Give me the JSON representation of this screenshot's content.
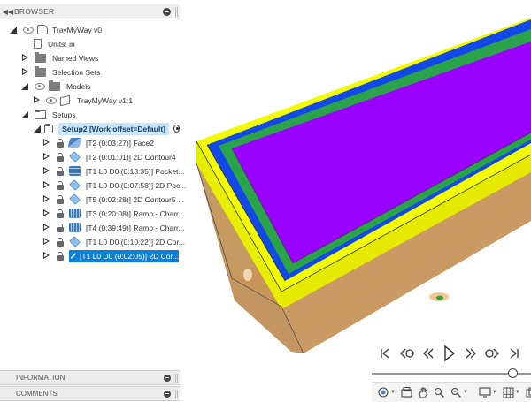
{
  "colors": {
    "selection": "#0b82d9",
    "setup_highlight": "#c6e4fb",
    "stock_top": "#9900ff",
    "contour_blue": "#1248e8",
    "contour_green": "#2aa34a",
    "stock_yellow": "#f2fb00",
    "wood_side": "#c69a63"
  },
  "browser": {
    "header": "BROWSER",
    "tree": [
      {
        "label": "TrayMyWay v0",
        "icon": "component-icon"
      },
      {
        "label": "Units: in",
        "icon": "document-icon"
      },
      {
        "label": "Named Views",
        "icon": "folder-icon"
      },
      {
        "label": "Selection Sets",
        "icon": "folder-icon"
      },
      {
        "label": "Models",
        "icon": "folder-icon"
      },
      {
        "label": "TrayMyWay v1:1",
        "icon": "body-icon"
      },
      {
        "label": "Setups",
        "icon": "folder-open-icon"
      },
      {
        "label": "Setup2 [Work offset=Default]",
        "icon": "folder-open-icon"
      }
    ],
    "operations": [
      {
        "label": "[T2 (0:03:27)] Face2",
        "icon": "face-op-icon"
      },
      {
        "label": "[T2 (0:01:01)] 2D Contour4",
        "icon": "contour-op-icon"
      },
      {
        "label": "[T1 L0 D0 (0:13:35)] Pocket...",
        "icon": "pocket-op-icon"
      },
      {
        "label": "[T1 L0 D0 (0:07:58)] 2D Poc...",
        "icon": "contour-op-icon"
      },
      {
        "label": "[T5 (0:02:28)] 2D Contour5 ...",
        "icon": "contour-op-icon"
      },
      {
        "label": "[T3 (0:20:08)] Ramp - Charr...",
        "icon": "ramp-op-icon"
      },
      {
        "label": "[T4 (0:39:49)] Ramp - Charr...",
        "icon": "ramp-op-icon"
      },
      {
        "label": "[T1 L0 D0 (0:10:22)] 2D Cor...",
        "icon": "contour-op-icon"
      },
      {
        "label": "[T1 L0 D0 (0:02:05)] 2D Cor...",
        "icon": "contour-op-icon",
        "selected": true
      }
    ]
  },
  "information": {
    "header": "INFORMATION"
  },
  "comments": {
    "header": "COMMENTS"
  },
  "playback": {
    "buttons": [
      "go-to-start-icon",
      "previous-icon",
      "rewind-icon",
      "play-icon",
      "fast-forward-icon",
      "next-icon",
      "go-to-end-icon"
    ],
    "timeline_position": 0.9
  },
  "nav_toolbar": {
    "tools": [
      "orbit-icon",
      "look-at-icon",
      "pan-icon",
      "zoom-window-icon",
      "zoom-icon",
      "display-settings-icon",
      "grid-icon",
      "viewports-icon"
    ]
  }
}
